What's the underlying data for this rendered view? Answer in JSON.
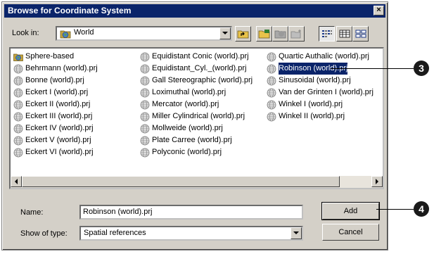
{
  "dialog": {
    "title": "Browse for Coordinate System",
    "close_label": "×"
  },
  "look_in": {
    "label": "Look in:",
    "value": "World"
  },
  "files": [
    {
      "name": "Sphere-based",
      "icon": "folder-globe-icon"
    },
    {
      "name": "Behrmann (world).prj",
      "icon": "globe-file-icon"
    },
    {
      "name": "Bonne (world).prj",
      "icon": "globe-file-icon"
    },
    {
      "name": "Eckert I (world).prj",
      "icon": "globe-file-icon"
    },
    {
      "name": "Eckert II (world).prj",
      "icon": "globe-file-icon"
    },
    {
      "name": "Eckert III (world).prj",
      "icon": "globe-file-icon"
    },
    {
      "name": "Eckert IV (world).prj",
      "icon": "globe-file-icon"
    },
    {
      "name": "Eckert V (world).prj",
      "icon": "globe-file-icon"
    },
    {
      "name": "Eckert VI (world).prj",
      "icon": "globe-file-icon"
    },
    {
      "name": "Equidistant Conic (world).prj",
      "icon": "globe-file-icon"
    },
    {
      "name": "Equidistant_Cyl._(world).prj",
      "icon": "globe-file-icon"
    },
    {
      "name": "Gall Stereographic (world).prj",
      "icon": "globe-file-icon"
    },
    {
      "name": "Loximuthal (world).prj",
      "icon": "globe-file-icon"
    },
    {
      "name": "Mercator (world).prj",
      "icon": "globe-file-icon"
    },
    {
      "name": "Miller Cylindrical (world).prj",
      "icon": "globe-file-icon"
    },
    {
      "name": "Mollweide (world).prj",
      "icon": "globe-file-icon"
    },
    {
      "name": "Plate Carree (world).prj",
      "icon": "globe-file-icon"
    },
    {
      "name": "Polyconic (world).prj",
      "icon": "globe-file-icon"
    },
    {
      "name": "Quartic Authalic (world).prj",
      "icon": "globe-file-icon"
    },
    {
      "name": "Robinson (world).prj",
      "icon": "globe-file-icon",
      "selected": true
    },
    {
      "name": "Sinusoidal (world).prj",
      "icon": "globe-file-icon"
    },
    {
      "name": "Van der Grinten I (world).prj",
      "icon": "globe-file-icon"
    },
    {
      "name": "Winkel I (world).prj",
      "icon": "globe-file-icon"
    },
    {
      "name": "Winkel II (world).prj",
      "icon": "globe-file-icon"
    }
  ],
  "name_field": {
    "label": "Name:",
    "value": "Robinson (world).prj"
  },
  "type_field": {
    "label": "Show of type:",
    "value": "Spatial references"
  },
  "buttons": {
    "add": "Add",
    "cancel": "Cancel"
  },
  "callouts": {
    "step3": "3",
    "step4": "4"
  },
  "colors": {
    "title_bar": "#0a246a",
    "selection": "#0a246a",
    "dialog_face": "#d4d0c8",
    "callout": "#1a1a1a"
  }
}
